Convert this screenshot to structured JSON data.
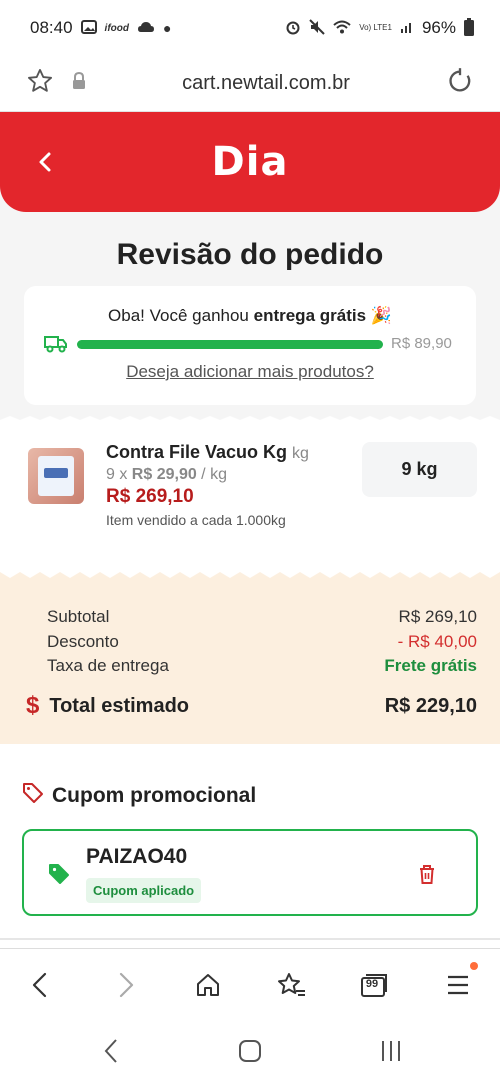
{
  "status_bar": {
    "time": "08:40",
    "carrier_icons": "ifood",
    "volte": "Vo) LTE1",
    "battery": "96%"
  },
  "browser": {
    "url": "cart.newtail.com.br"
  },
  "header": {
    "logo": "Dia",
    "brand_color": "#e3262c"
  },
  "page": {
    "title": "Revisão do pedido"
  },
  "promo": {
    "message_prefix": "Oba! Você ganhou ",
    "message_bold": "entrega grátis",
    "emoji": "🎉",
    "progress_percent": 100,
    "threshold": "R$ 89,90",
    "link": "Deseja adicionar mais produtos?"
  },
  "product": {
    "name": "Contra File Vacuo Kg",
    "unit": "kg",
    "qty_prefix": "9 x ",
    "unit_price": "R$ 29,90",
    "unit_suffix": " / kg",
    "total_price": "R$ 269,10",
    "note": "Item vendido a cada 1.000kg",
    "quantity": "9 kg"
  },
  "summary": {
    "subtotal_label": "Subtotal",
    "subtotal_value": "R$ 269,10",
    "discount_label": "Desconto",
    "discount_value": "- R$ 40,00",
    "delivery_label": "Taxa de entrega",
    "delivery_value": "Frete grátis",
    "total_symbol": "$",
    "total_label": "Total estimado",
    "total_value": "R$ 229,10"
  },
  "coupon": {
    "section_title": "Cupom promocional",
    "code": "PAIZAO40",
    "status": "Cupom aplicado"
  },
  "bottom_nav": {
    "tabs_count": "99"
  },
  "colors": {
    "accent_red": "#e3262c",
    "success_green": "#22b24c",
    "price_red": "#b71c1c",
    "summary_bg": "#fcefdf"
  }
}
